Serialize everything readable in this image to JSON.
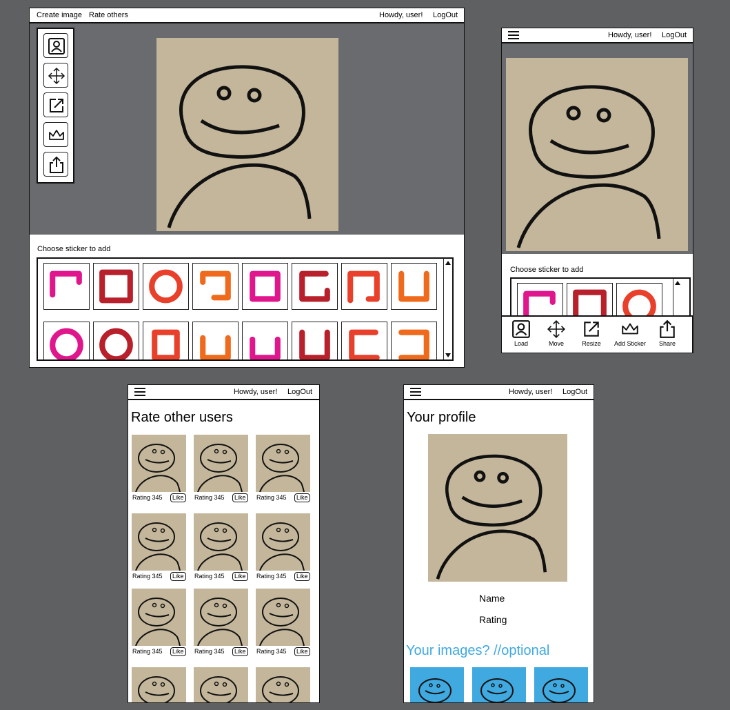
{
  "desktop": {
    "nav_create": "Create image",
    "nav_rate": "Rate others",
    "greeting": "Howdy, user!",
    "logout": "LogOut",
    "sticker_label": "Choose sticker to add",
    "tools": [
      "user-icon",
      "move-icon",
      "resize-icon",
      "crown-icon",
      "share-icon"
    ]
  },
  "mobile_editor": {
    "greeting": "Howdy, user!",
    "logout": "LogOut",
    "sticker_label": "Choose sticker to add",
    "toolbar": [
      {
        "label": "Load",
        "icon": "user-icon"
      },
      {
        "label": "Move",
        "icon": "move-icon"
      },
      {
        "label": "Resize",
        "icon": "resize-icon"
      },
      {
        "label": "Add Sticker",
        "icon": "crown-icon"
      },
      {
        "label": "Share",
        "icon": "share-icon"
      }
    ]
  },
  "rate_screen": {
    "greeting": "Howdy, user!",
    "logout": "LogOut",
    "title": "Rate other users",
    "rating_text": "Rating 345",
    "like_label": "Like"
  },
  "profile_screen": {
    "greeting": "Howdy, user!",
    "logout": "LogOut",
    "title": "Your profile",
    "name_label": "Name",
    "rating_label": "Rating",
    "images_heading": "Your images? //optional"
  },
  "colors": {
    "background": "#5f6062",
    "canvas": "#c3b69a",
    "accent_blue": "#3fa9e0",
    "sticker_magenta": "#e0168d",
    "sticker_crimson": "#b8202b",
    "sticker_red": "#e8402b",
    "sticker_orange": "#ef6a1c"
  }
}
